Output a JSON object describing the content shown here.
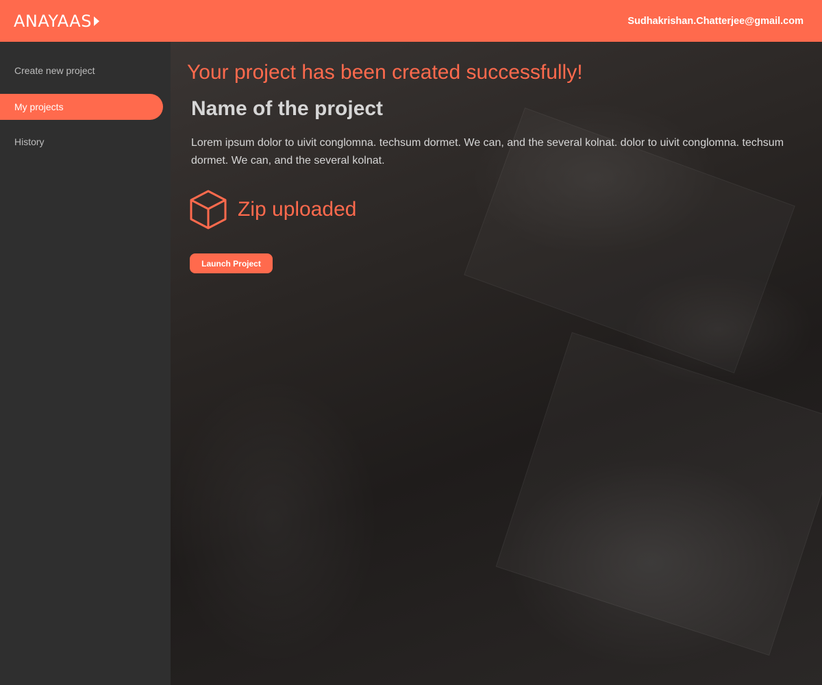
{
  "header": {
    "logo_text": "ANAYAAS",
    "user_email": "Sudhakrishan.Chatterjee@gmail.com"
  },
  "sidebar": {
    "items": [
      {
        "label": "Create new project",
        "active": false
      },
      {
        "label": "My projects",
        "active": true
      },
      {
        "label": "History",
        "active": false
      }
    ]
  },
  "main": {
    "success_message": "Your project has been created successfully!",
    "project_name": "Name of the project",
    "project_description": "Lorem ipsum dolor to uivit conglomna. techsum dormet. We can, and the several kolnat. dolor to uivit conglomna. techsum dormet. We can, and the several kolnat.",
    "zip_status": {
      "icon": "cube-icon",
      "label": "Zip uploaded"
    },
    "launch_button_label": "Launch Project"
  },
  "colors": {
    "accent": "#ff6a4d",
    "sidebar_bg": "#2f2f2f",
    "text_light": "#d6d6d6",
    "nav_text": "#bdbdbd"
  }
}
